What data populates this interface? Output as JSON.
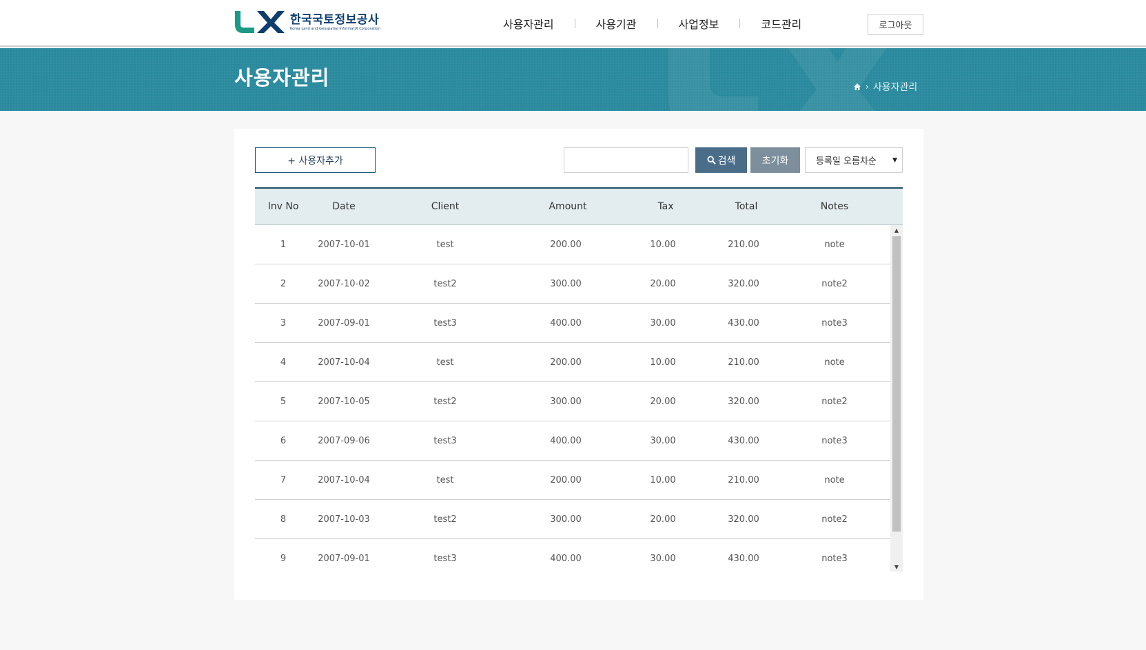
{
  "brand": {
    "logo_mark": "LX",
    "name_kr": "한국국토정보공사",
    "name_en": "Korea Land and Geospatial InformatiX Corporation",
    "colors": {
      "teal": "#1a9a86",
      "navy": "#0f3d6e",
      "banner": "#2b8a9e"
    }
  },
  "nav": {
    "items": [
      "사용자관리",
      "사용기관",
      "사업정보",
      "코드관리"
    ],
    "logout_label": "로그아웃"
  },
  "banner": {
    "title": "사용자관리",
    "breadcrumb": {
      "home_icon": "home-icon",
      "current": "사용자관리"
    }
  },
  "toolbar": {
    "add_label": "+ 사용자추가",
    "search_value": "",
    "search_placeholder": "",
    "search_label": "검색",
    "search_icon": "search-icon",
    "reset_label": "초기화",
    "sort_selected": "등록일 오름차순"
  },
  "table": {
    "columns": [
      "Inv No",
      "Date",
      "Client",
      "Amount",
      "Tax",
      "Total",
      "Notes"
    ],
    "rows": [
      [
        "1",
        "2007-10-01",
        "test",
        "200.00",
        "10.00",
        "210.00",
        "note"
      ],
      [
        "2",
        "2007-10-02",
        "test2",
        "300.00",
        "20.00",
        "320.00",
        "note2"
      ],
      [
        "3",
        "2007-09-01",
        "test3",
        "400.00",
        "30.00",
        "430.00",
        "note3"
      ],
      [
        "4",
        "2007-10-04",
        "test",
        "200.00",
        "10.00",
        "210.00",
        "note"
      ],
      [
        "5",
        "2007-10-05",
        "test2",
        "300.00",
        "20.00",
        "320.00",
        "note2"
      ],
      [
        "6",
        "2007-09-06",
        "test3",
        "400.00",
        "30.00",
        "430.00",
        "note3"
      ],
      [
        "7",
        "2007-10-04",
        "test",
        "200.00",
        "10.00",
        "210.00",
        "note"
      ],
      [
        "8",
        "2007-10-03",
        "test2",
        "300.00",
        "20.00",
        "320.00",
        "note2"
      ],
      [
        "9",
        "2007-09-01",
        "test3",
        "400.00",
        "30.00",
        "430.00",
        "note3"
      ]
    ]
  }
}
